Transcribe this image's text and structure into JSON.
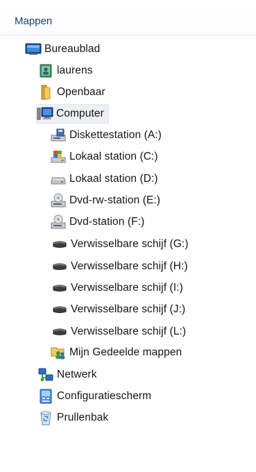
{
  "header": {
    "title": "Mappen"
  },
  "tree": {
    "items": [
      {
        "label": "Bureaublad",
        "icon": "desktop-icon",
        "level": 0
      },
      {
        "label": "laurens",
        "icon": "user-folder-icon",
        "level": 1
      },
      {
        "label": "Openbaar",
        "icon": "folder-icon",
        "level": 1
      },
      {
        "label": "Computer",
        "icon": "computer-icon",
        "level": 1,
        "selected": true
      },
      {
        "label": "Diskettestation (A:)",
        "icon": "floppy-drive-icon",
        "level": 2
      },
      {
        "label": "Lokaal station (C:)",
        "icon": "system-drive-icon",
        "level": 2
      },
      {
        "label": "Lokaal station (D:)",
        "icon": "hard-drive-icon",
        "level": 2
      },
      {
        "label": "Dvd-rw-station (E:)",
        "icon": "dvd-drive-icon",
        "level": 2
      },
      {
        "label": "Dvd-station (F:)",
        "icon": "dvd-drive-icon",
        "level": 2
      },
      {
        "label": "Verwisselbare schijf (G:)",
        "icon": "removable-drive-icon",
        "level": 2
      },
      {
        "label": "Verwisselbare schijf (H:)",
        "icon": "removable-drive-icon",
        "level": 2
      },
      {
        "label": "Verwisselbare schijf (I:)",
        "icon": "removable-drive-icon",
        "level": 2
      },
      {
        "label": "Verwisselbare schijf (J:)",
        "icon": "removable-drive-icon",
        "level": 2
      },
      {
        "label": "Verwisselbare schijf (L:)",
        "icon": "removable-drive-icon",
        "level": 2
      },
      {
        "label": "Mijn Gedeelde mappen",
        "icon": "shared-folders-icon",
        "level": 2
      },
      {
        "label": "Netwerk",
        "icon": "network-icon",
        "level": 1
      },
      {
        "label": "Configuratiescherm",
        "icon": "control-panel-icon",
        "level": 1
      },
      {
        "label": "Prullenbak",
        "icon": "recycle-bin-icon",
        "level": 1
      }
    ]
  },
  "colors": {
    "header_text": "#1f3f6e",
    "item_text": "#151515",
    "selection_bg": "#eef0f3"
  }
}
